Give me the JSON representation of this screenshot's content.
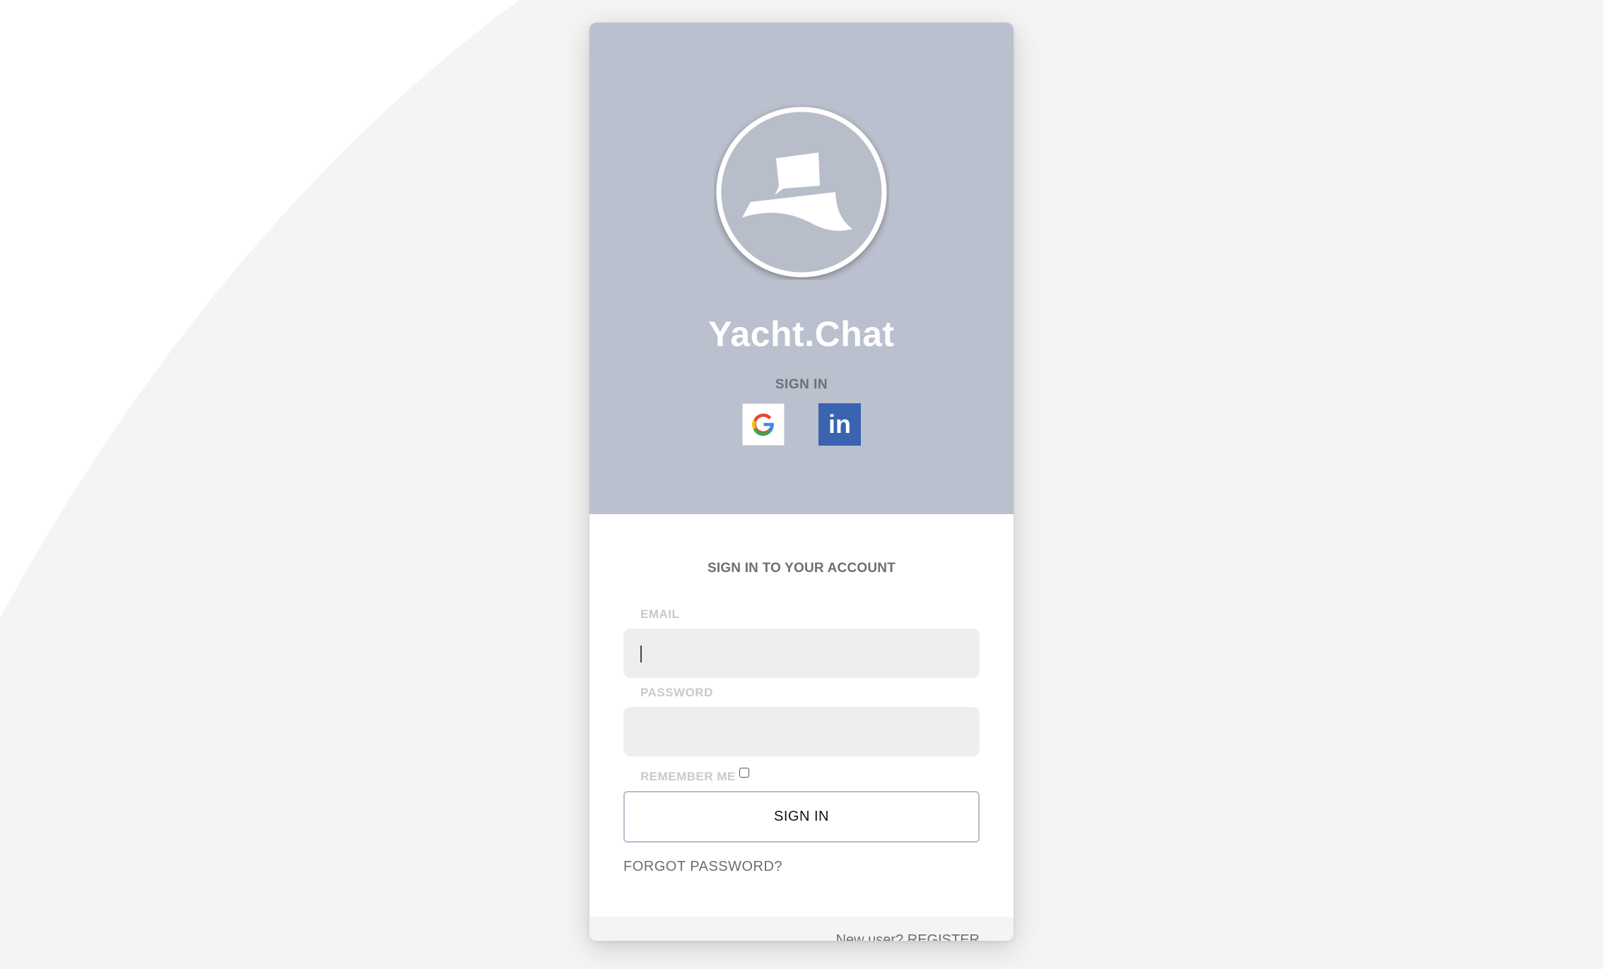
{
  "colors": {
    "page_background": "#f4f4f4",
    "hero_background": "#bac0cd",
    "card_background": "#ffffff",
    "input_background": "#eeeeee",
    "linkedin_brand": "#3a63b0",
    "button_border": "#b6bccb"
  },
  "hero": {
    "logo_icon": "yacht-logo-icon",
    "brand_name": "Yacht.Chat",
    "signin_heading": "SIGN IN",
    "social_buttons": [
      {
        "name": "google",
        "icon": "google-icon"
      },
      {
        "name": "linkedin",
        "icon": "linkedin-icon",
        "glyph": "in"
      }
    ]
  },
  "form": {
    "title": "SIGN IN TO YOUR ACCOUNT",
    "email": {
      "label": "EMAIL",
      "value": "",
      "placeholder": ""
    },
    "password": {
      "label": "PASSWORD",
      "value": "",
      "placeholder": ""
    },
    "remember_me": {
      "label": "REMEMBER ME",
      "checked": false
    },
    "submit_label": "SIGN IN",
    "forgot_link": "FORGOT PASSWORD?"
  },
  "footer": {
    "prompt": "New user?",
    "register_link": "REGISTER"
  }
}
